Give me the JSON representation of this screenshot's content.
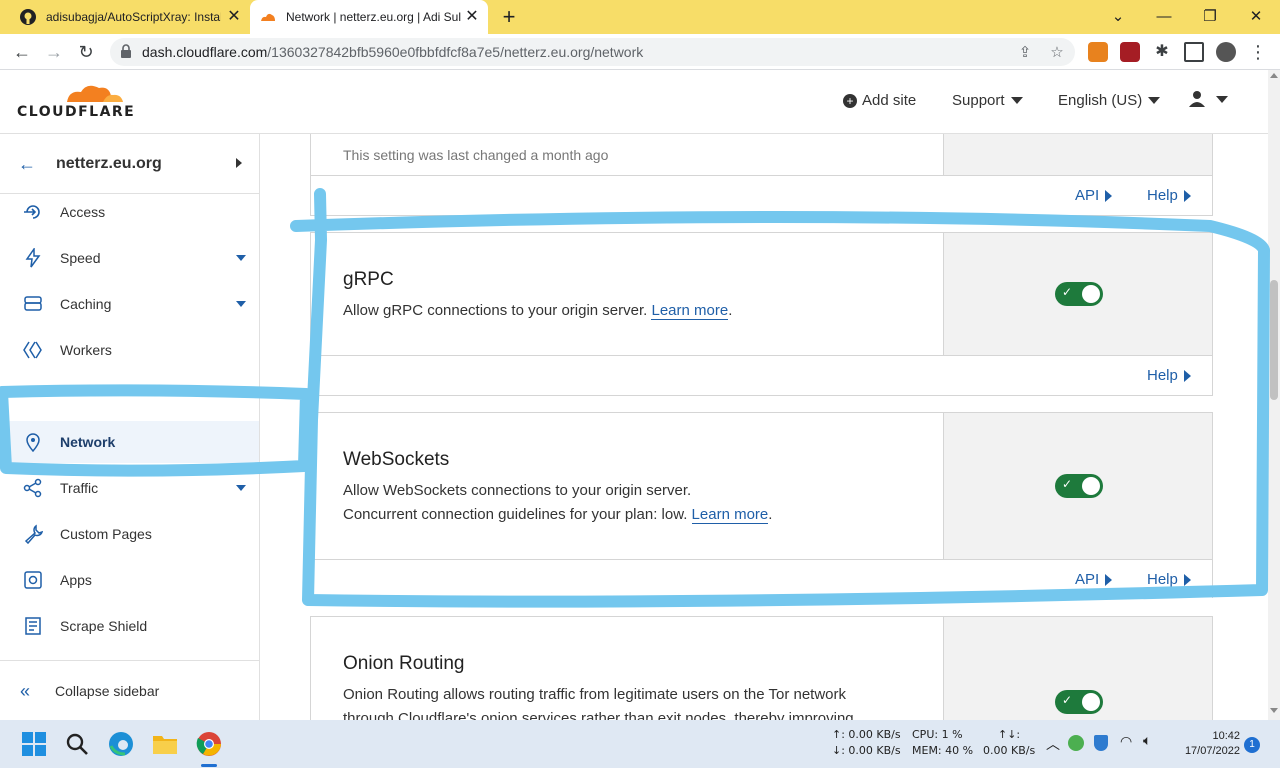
{
  "browser": {
    "tabs": [
      {
        "title": "adisubagja/AutoScriptXray: Instal"
      },
      {
        "title": "Network | netterz.eu.org | Adi Sul"
      }
    ],
    "url_host": "dash.cloudflare.com",
    "url_path": "/1360327842bfb5960e0fbbfdfcf8a7e5/netterz.eu.org/network"
  },
  "header": {
    "logo_text": "CLOUDFLARE",
    "add_site": "Add site",
    "support": "Support",
    "language": "English (US)"
  },
  "sidebar": {
    "site_name": "netterz.eu.org",
    "items": [
      {
        "label": "Access",
        "icon": "access-icon",
        "has_caret": false
      },
      {
        "label": "Speed",
        "icon": "lightning-icon",
        "has_caret": true
      },
      {
        "label": "Caching",
        "icon": "database-icon",
        "has_caret": true
      },
      {
        "label": "Workers",
        "icon": "workers-icon",
        "has_caret": false
      },
      {
        "label": "Network",
        "icon": "location-pin-icon",
        "has_caret": false,
        "active": true
      },
      {
        "label": "Traffic",
        "icon": "traffic-icon",
        "has_caret": true
      },
      {
        "label": "Custom Pages",
        "icon": "wrench-icon",
        "has_caret": false
      },
      {
        "label": "Apps",
        "icon": "apps-icon",
        "has_caret": false
      },
      {
        "label": "Scrape Shield",
        "icon": "document-icon",
        "has_caret": false
      }
    ],
    "collapse_label": "Collapse sidebar"
  },
  "cards": {
    "prev_partial_text": "This setting was last changed a month ago",
    "prev_footer": {
      "api": "API",
      "help": "Help"
    },
    "grpc": {
      "title": "gRPC",
      "desc": "Allow gRPC connections to your origin server.",
      "link": "Learn more",
      "enabled": true,
      "help": "Help"
    },
    "websockets": {
      "title": "WebSockets",
      "desc_line1": "Allow WebSockets connections to your origin server.",
      "desc_line2": "Concurrent connection guidelines for your plan: low.",
      "link": "Learn more",
      "enabled": true,
      "api": "API",
      "help": "Help"
    },
    "onion": {
      "title": "Onion Routing",
      "desc_line1": "Onion Routing allows routing traffic from legitimate users on the Tor network",
      "desc_line2": "through Cloudflare's onion services rather than exit nodes, thereby improving",
      "enabled": true
    }
  },
  "colors": {
    "highlight": "#74c7ee",
    "toggle_on": "#1e7a3c",
    "link": "#1f5fa8",
    "tabbar": "#f7dd68"
  },
  "taskbar": {
    "net_up": "↑: 0.00 KB/s",
    "net_down": "↓: 0.00 KB/s",
    "cpu": "CPU: 1 %",
    "mem": "MEM: 40 %",
    "net_total_label": "↑↓:",
    "net_total": "0.00 KB/s",
    "time": "10:42",
    "date": "17/07/2022",
    "notifications": "1"
  }
}
